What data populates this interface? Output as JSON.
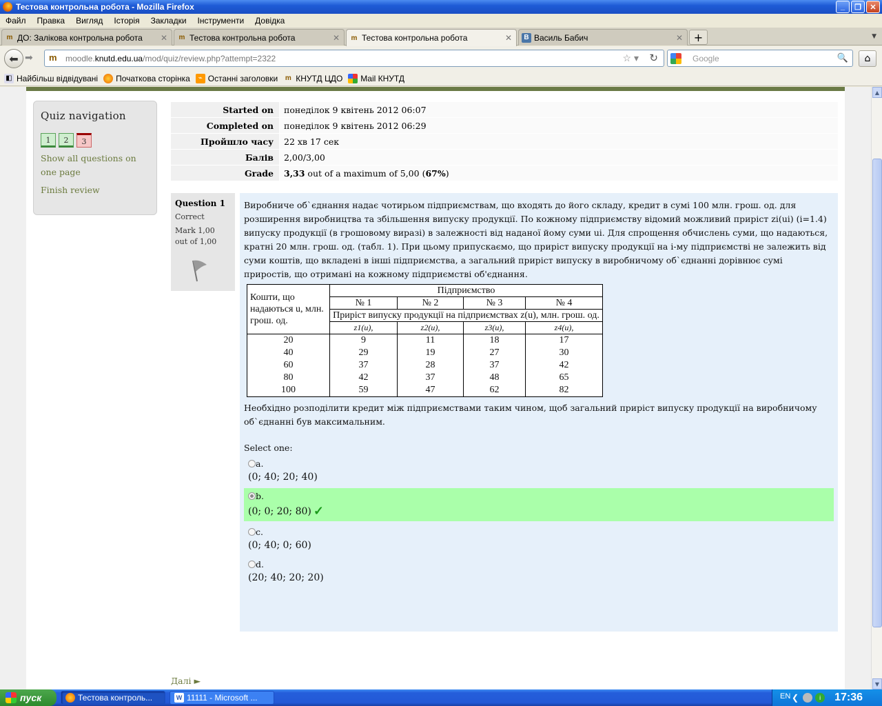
{
  "window": {
    "title": "Тестова контрольна робота - Mozilla Firefox"
  },
  "menu": [
    "Файл",
    "Правка",
    "Вигляд",
    "Історія",
    "Закладки",
    "Інструменти",
    "Довідка"
  ],
  "tabs": [
    {
      "label": "ДО: Залікова контрольна робота"
    },
    {
      "label": "Тестова контрольна робота"
    },
    {
      "label": "Тестова контрольна робота"
    },
    {
      "label": "Василь Бабич"
    }
  ],
  "url": {
    "host_pre": "moodle.",
    "host": "knutd.edu.ua",
    "path": "/mod/quiz/review.php?attempt=2322"
  },
  "search": {
    "placeholder": "Google"
  },
  "bookmarks": [
    "Найбільш відвідувані",
    "Початкова сторінка",
    "Останні заголовки",
    "КНУТД ЦДО",
    "Mail КНУТД"
  ],
  "quiz_nav": {
    "title": "Quiz navigation",
    "buttons": [
      "1",
      "2",
      "3"
    ],
    "show_all": "Show all questions on one page",
    "finish": "Finish review"
  },
  "summary": [
    {
      "k": "Started on",
      "v": "понеділок 9 квітень 2012 06:07"
    },
    {
      "k": "Completed on",
      "v": "понеділок 9 квітень 2012 06:29"
    },
    {
      "k": "Пройшло часу",
      "v": "22 хв 17 сек"
    },
    {
      "k": "Балів",
      "v": "2,00/3,00"
    },
    {
      "k": "Grade",
      "v_bold": "3,33",
      "v_mid": " out of a maximum of 5,00 (",
      "v_pct": "67%",
      "v_end": ")"
    }
  ],
  "question": {
    "number_label": "Question",
    "number": "1",
    "state": "Correct",
    "mark": "Mark 1,00 out of 1,00",
    "text": "Виробниче об`єднання надає чотирьом підприємствам, що входять до його складу, кредит в сумі 100 млн. грош. од. для розширення виробництва та збільшення випуску продукції. По кожному підприємству відомий можливий приріст zi(ui) (i=1.4) випуску продукції (в грошовому виразі) в залежності від наданої йому суми ui. Для спрощення обчислень суми, що надаються, кратні 20 млн. грош. од. (табл. 1). При цьому припускаємо, що приріст випуску продукції на i-му підприємстві не залежить від суми коштів, що вкладені в інші підприємства, а загальний приріст випуску в виробничому об`єднанні дорівнює сумі приростів, що отримані на кожному підприємстві об'єднання.",
    "table": {
      "left_header": "Кошти, що надаються u, млн. грош. од.",
      "top_header": "Підприємство",
      "firms": [
        "№ 1",
        "№ 2",
        "№ 3",
        "№ 4"
      ],
      "growth_header": "Приріст випуску продукції на підприємствах z(u), млн. грош. од.",
      "sub": [
        "z1(u),",
        "z2(u),",
        "z3(u),",
        "z4(u),"
      ],
      "rows": [
        [
          "20",
          "9",
          "11",
          "18",
          "17"
        ],
        [
          "40",
          "29",
          "19",
          "27",
          "30"
        ],
        [
          "60",
          "37",
          "28",
          "37",
          "42"
        ],
        [
          "80",
          "42",
          "37",
          "48",
          "65"
        ],
        [
          "100",
          "59",
          "47",
          "62",
          "82"
        ]
      ]
    },
    "text2": "Необхідно розподілити кредит між підприємствами таким чином, щоб загальний приріст випуску продукції на виробничому об`єднанні був максимальним.",
    "select_label": "Select one:",
    "options": [
      {
        "letter": "a.",
        "answer": "(0; 40; 20; 40)"
      },
      {
        "letter": "b.",
        "answer": "(0; 0; 20; 80)"
      },
      {
        "letter": "c.",
        "answer": "(0; 40; 0; 60)"
      },
      {
        "letter": "d.",
        "answer": "(20; 40; 20; 20)"
      }
    ]
  },
  "next_label": "Далі ►",
  "taskbar": {
    "start": "пуск",
    "tasks": [
      "Тестова контроль...",
      "11111 - Microsoft ..."
    ],
    "lang": "EN",
    "clock": "17:36"
  }
}
